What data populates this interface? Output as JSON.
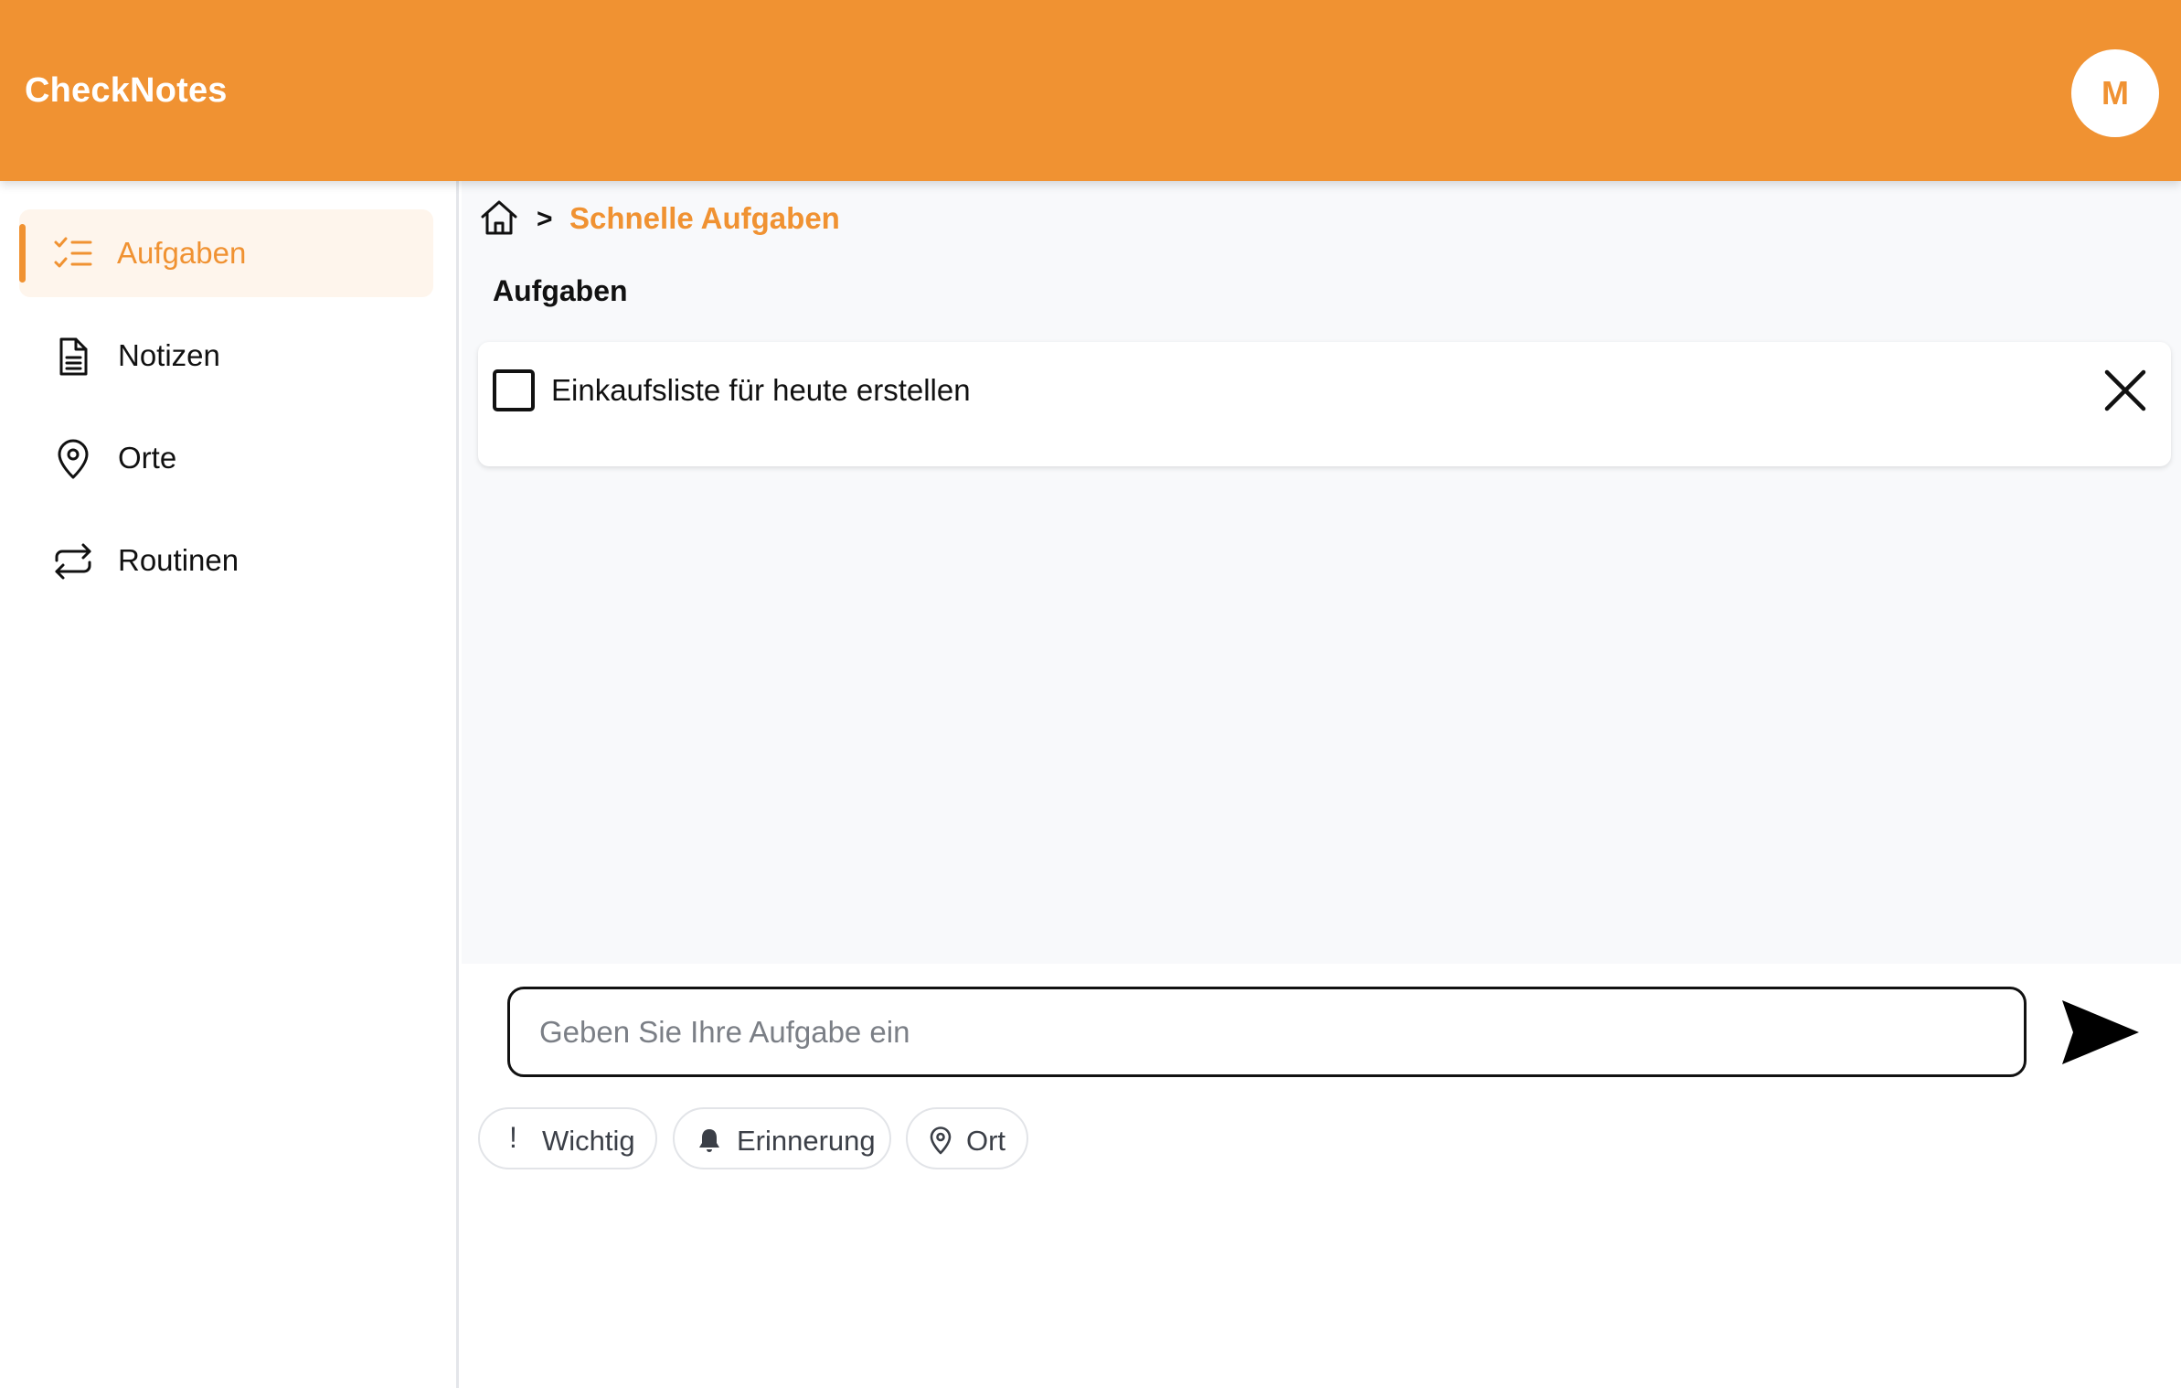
{
  "header": {
    "app_title": "CheckNotes",
    "avatar_initial": "M"
  },
  "sidebar": {
    "items": [
      {
        "label": "Aufgaben",
        "icon": "task-list-icon",
        "active": true
      },
      {
        "label": "Notizen",
        "icon": "document-icon",
        "active": false
      },
      {
        "label": "Orte",
        "icon": "map-pin-icon",
        "active": false
      },
      {
        "label": "Routinen",
        "icon": "repeat-icon",
        "active": false
      }
    ]
  },
  "breadcrumb": {
    "home_icon": "home-icon",
    "separator": ">",
    "current": "Schnelle Aufgaben"
  },
  "main": {
    "section_title": "Aufgaben",
    "tasks": [
      {
        "text": "Einkaufsliste für heute erstellen",
        "done": false
      }
    ]
  },
  "composer": {
    "placeholder": "Geben Sie Ihre Aufgabe ein",
    "send_icon": "send-icon",
    "chips": [
      {
        "label": "Wichtig",
        "icon": "exclamation-icon"
      },
      {
        "label": "Erinnerung",
        "icon": "bell-icon"
      },
      {
        "label": "Ort",
        "icon": "map-pin-icon"
      }
    ]
  },
  "colors": {
    "accent": "#F09232",
    "active_bg": "#FEF5EC",
    "main_bg": "#F8F9FB"
  }
}
